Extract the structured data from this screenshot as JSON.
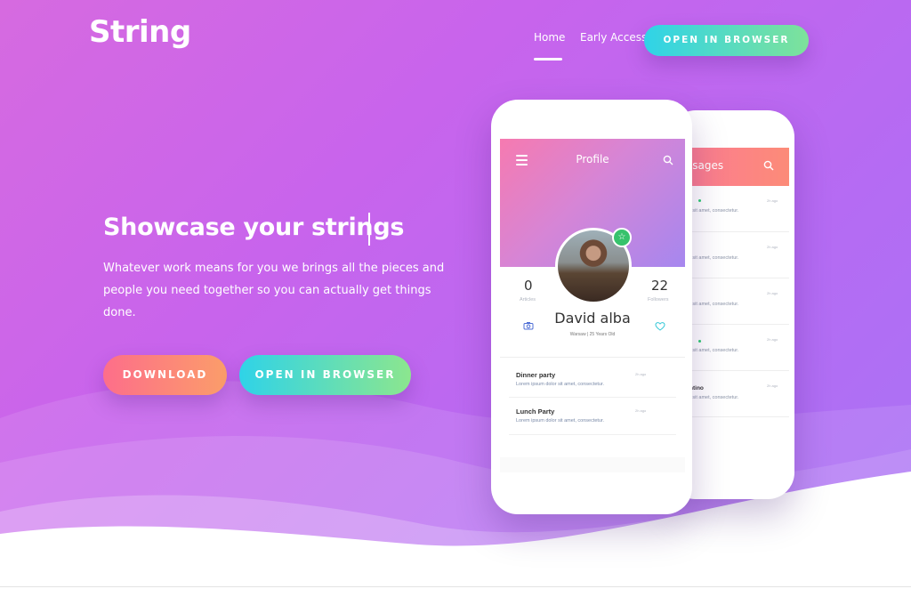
{
  "brand": {
    "logo": "String"
  },
  "nav": {
    "home": "Home",
    "early_access": "Early Access",
    "cta": "OPEN IN BROWSER"
  },
  "hero": {
    "headline": "Showcase your strings",
    "subtext": "Whatever work means for you we brings all the pieces and people you need together so you can actually get things done.",
    "download": "DOWNLOAD",
    "open_browser": "OPEN IN BROWSER"
  },
  "phone_back": {
    "title": "ssages",
    "messages": [
      {
        "name": "",
        "text": "r sit amet, consectetur.",
        "time": "2h ago",
        "online": true
      },
      {
        "name": "",
        "text": "r sit amet, consectetur.",
        "time": "2h ago",
        "online": false
      },
      {
        "name": "",
        "text": "r sit amet, consectetur.",
        "time": "2h ago",
        "online": false
      },
      {
        "name": "",
        "text": "r sit amet, consectetur.",
        "time": "2h ago",
        "online": true
      },
      {
        "name": "ntino",
        "text": "r sit amet, consectetur.",
        "time": "2h ago",
        "online": false
      }
    ]
  },
  "phone_front": {
    "title": "Profile",
    "stats": {
      "articles_count": "0",
      "articles_label": "Articles",
      "followers_count": "22",
      "followers_label": "Followers"
    },
    "name": "David alba",
    "meta": "Warsaw | 25 Years Old",
    "items": [
      {
        "title": "Dinner party",
        "text": "Lorem ipsum dolor sit amet, consectetur.",
        "time": "2h ago"
      },
      {
        "title": "Lunch Party",
        "text": "Lorem ipsum dolor sit amet, consectetur.",
        "time": "2h ago"
      }
    ]
  },
  "colors": {
    "hero_gradient_start": "#d66ae0",
    "hero_gradient_end": "#a874f5",
    "cta_gradient_start": "#2fd3e8",
    "cta_gradient_end": "#8ce68e",
    "download_gradient_start": "#fd6e8a",
    "download_gradient_end": "#fb9d6a",
    "online_badge": "#37c26d"
  },
  "icons": [
    "menu-icon",
    "search-icon",
    "star-icon",
    "camera-icon",
    "heart-icon"
  ]
}
